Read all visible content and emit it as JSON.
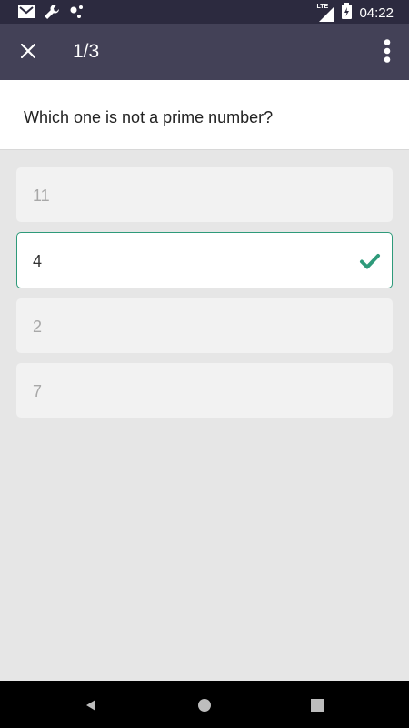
{
  "status_bar": {
    "time": "04:22",
    "network_label": "LTE",
    "icons": [
      "gmail-icon",
      "wrench-icon",
      "notification-dots-icon",
      "signal-icon",
      "battery-icon"
    ]
  },
  "app_bar": {
    "counter": "1/3",
    "close_icon": "close-icon",
    "menu_icon": "more-vertical-icon"
  },
  "question": {
    "text": "Which one is not a prime number?"
  },
  "options": [
    {
      "label": "11",
      "selected": false
    },
    {
      "label": "4",
      "selected": true
    },
    {
      "label": "2",
      "selected": false
    },
    {
      "label": "7",
      "selected": false
    }
  ],
  "colors": {
    "status_bar": "#2c2a3f",
    "app_bar": "#434157",
    "accent": "#2e9a7a",
    "background": "#e6e6e6"
  }
}
